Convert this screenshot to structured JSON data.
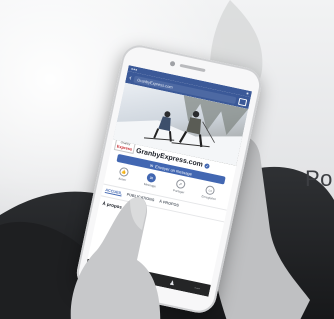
{
  "tagline": "Po",
  "phone": {
    "status_left": "●●●",
    "status_right": "■",
    "search_text": "GranbyExpress.com",
    "page_name": "GranbyExpress.com",
    "logo_line1": "Granby",
    "logo_line2": "Express",
    "cta_label": "Envoyer un message",
    "actions": [
      {
        "label": "Aimer",
        "icon": "like-icon"
      },
      {
        "label": "Message",
        "icon": "message-icon"
      },
      {
        "label": "Partager",
        "icon": "share-icon"
      },
      {
        "label": "Enregistrer",
        "icon": "save-icon"
      }
    ],
    "tabs": [
      "ACCUEIL",
      "PUBLICATIONS",
      "À PROPOS"
    ],
    "about_label": "À propos de",
    "bottom_icons": [
      "home-icon",
      "feed-icon",
      "camera-icon",
      "profile-icon",
      "menu-icon"
    ]
  },
  "colors": {
    "facebook_blue": "#3b5998",
    "button_blue": "#4267b2",
    "logo_red": "#c41f25"
  }
}
